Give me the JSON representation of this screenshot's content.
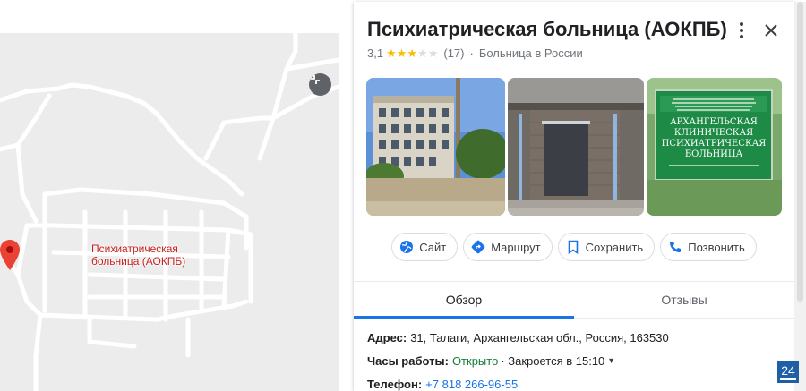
{
  "map": {
    "marker_label": "Психиатрическая больница (АОКПБ)"
  },
  "place": {
    "title": "Психиатрическая больница (АОКПБ)",
    "rating": "3,1",
    "stars": 3,
    "stars_max": 5,
    "reviews_count": "(17)",
    "separator": "·",
    "category": "Больница в России"
  },
  "photos": {
    "photo3_sign": {
      "line1": "АРХАНГЕЛЬСКАЯ",
      "line2": "КЛИНИЧЕСКАЯ",
      "line3": "ПСИХИАТРИЧЕСКАЯ",
      "line4": "БОЛЬНИЦА"
    }
  },
  "actions": [
    {
      "label": "Сайт",
      "icon": "globe-icon"
    },
    {
      "label": "Маршрут",
      "icon": "directions-icon"
    },
    {
      "label": "Сохранить",
      "icon": "bookmark-icon"
    },
    {
      "label": "Позвонить",
      "icon": "phone-icon"
    }
  ],
  "tabs": [
    {
      "label": "Обзор",
      "active": true
    },
    {
      "label": "Отзывы",
      "active": false
    }
  ],
  "info": {
    "address_label": "Адрес:",
    "address_value": "31, Талаги, Архангельская обл., Россия, 163530",
    "hours_label": "Часы работы:",
    "hours_open": "Открыто",
    "hours_rest": "· Закроется в 15:10",
    "phone_label": "Телефон:",
    "phone_value": "+7 818 266-96-55"
  },
  "badge": {
    "text": "24"
  },
  "colors": {
    "accent": "#1a73e8",
    "marker": "#ea4335",
    "open": "#188038",
    "star": "#fbbc04"
  }
}
